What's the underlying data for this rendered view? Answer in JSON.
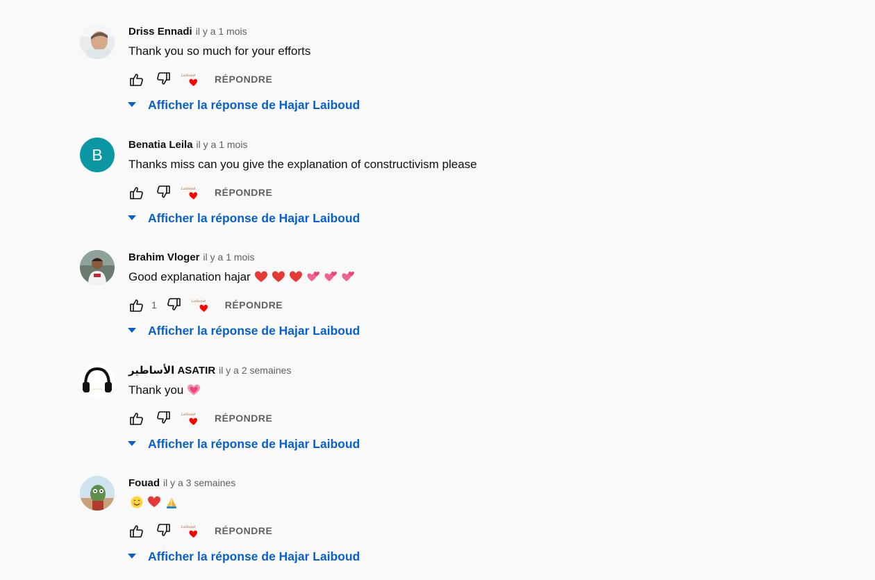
{
  "ui": {
    "reply_label": "RÉPONDRE",
    "accent_color": "#065fd4"
  },
  "comments": [
    {
      "author": "Driss Ennadi",
      "time": "il y a 1 mois",
      "text": "Thank you so much for your efforts",
      "emojis": [],
      "likes": "",
      "avatar": "photo-man",
      "replies_toggle": "Afficher la réponse de Hajar Laiboud"
    },
    {
      "author": "Benatia Leila",
      "time": "il y a 1 mois",
      "text": "Thanks miss can you give the explanation of constructivism please",
      "emojis": [],
      "likes": "",
      "avatar": "letter",
      "avatar_letter": "B",
      "replies_toggle": "Afficher la réponse de Hajar Laiboud"
    },
    {
      "author": "Brahim Vloger",
      "time": "il y a 1 mois",
      "text": "Good explanation hajar",
      "emojis": [
        "red-heart",
        "red-heart",
        "red-heart",
        "two-hearts",
        "two-hearts",
        "two-hearts"
      ],
      "likes": "1",
      "avatar": "photo-person",
      "replies_toggle": "Afficher la réponse de Hajar Laiboud"
    },
    {
      "author": "الأساطير ASATIR",
      "time": "il y a 2 semaines",
      "text": "Thank you",
      "emojis": [
        "heartbeat"
      ],
      "likes": "",
      "avatar": "headphones",
      "replies_toggle": "Afficher la réponse de Hajar Laiboud"
    },
    {
      "author": "Fouad",
      "time": "il y a 3 semaines",
      "text": "",
      "emojis": [
        "smiling-face",
        "red-heart",
        "folded-hands"
      ],
      "likes": "",
      "avatar": "photo-cartoon",
      "replies_toggle": "Afficher la réponse de Hajar Laiboud"
    }
  ]
}
